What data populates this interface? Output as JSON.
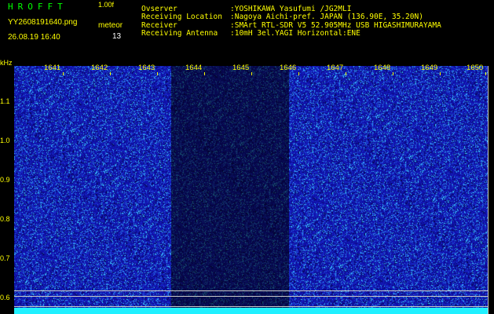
{
  "header": {
    "logo": "HROFFT",
    "version": "1.00f",
    "filename": "YY2608191640.png",
    "datetime": "26.08.19 16:40",
    "meteor_label": "meteor",
    "meteor_count": "13"
  },
  "info": [
    {
      "key": "Ovserver",
      "value": ":YOSHIKAWA Yasufumi /JG2MLI"
    },
    {
      "key": "Receiving Location",
      "value": ":Nagoya Aichi-pref. JAPAN (136.90E, 35.20N)"
    },
    {
      "key": "Receiver",
      "value": ":SMArt RTL-SDR V5 52.905MHz USB HIGASHIMURAYAMA"
    },
    {
      "key": "Receiving Antenna",
      "value": ":10mH 3el.YAGI Horizontal:ENE"
    }
  ],
  "y_unit": "kHz",
  "y_ticks": [
    "1.1",
    "1.0",
    "0.9",
    "0.8",
    "0.7",
    "0.6"
  ],
  "x_ticks": [
    "1641",
    "1642",
    "1643",
    "1644",
    "1645",
    "1646",
    "1647",
    "1648",
    "1649",
    "1650"
  ],
  "colors": {
    "background": "#000000",
    "spectrum": "#1010a8",
    "noise_bright": "#40d0ff",
    "label": "#ffff00",
    "logo": "#00ff00",
    "baseline": "#20f0ff"
  }
}
